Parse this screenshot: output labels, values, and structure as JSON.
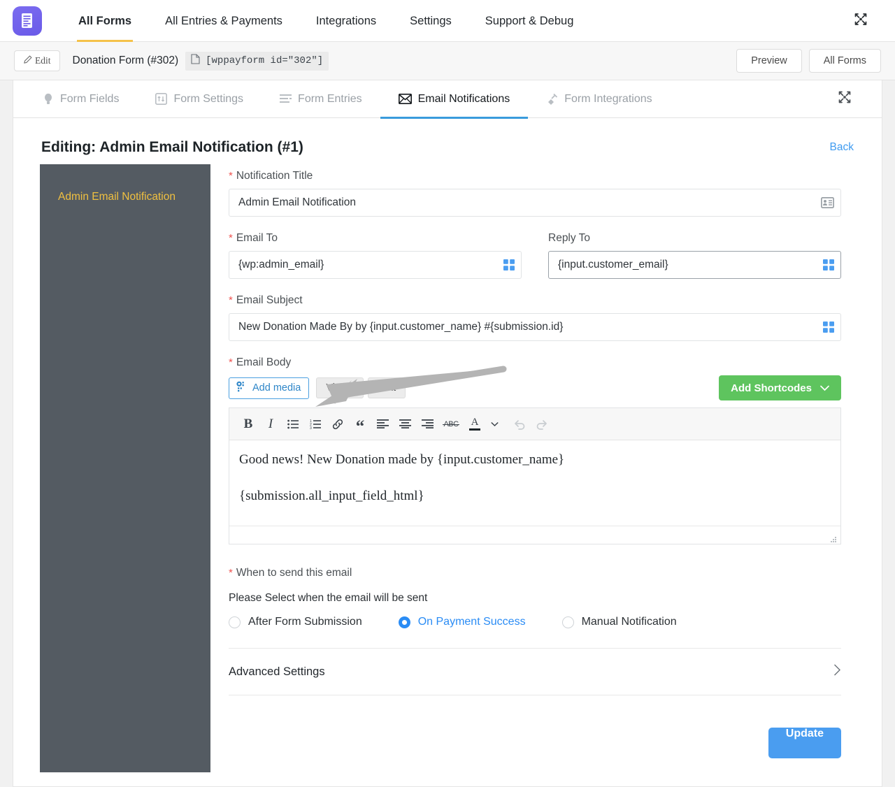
{
  "topnav": {
    "logo_icon": "document-stack-icon",
    "items": [
      {
        "label": "All Forms",
        "active": true
      },
      {
        "label": "All Entries & Payments",
        "active": false
      },
      {
        "label": "Integrations",
        "active": false
      },
      {
        "label": "Settings",
        "active": false
      },
      {
        "label": "Support & Debug",
        "active": false
      }
    ],
    "expand_icon": "expand-arrows-icon"
  },
  "formbar": {
    "edit_label": "Edit",
    "edit_icon": "pencil-icon",
    "form_title": "Donation Form (#302)",
    "shortcode_icon": "copy-page-icon",
    "shortcode": "[wppayform id=\"302\"]",
    "preview_label": "Preview",
    "all_forms_label": "All Forms"
  },
  "subtabs": {
    "items": [
      {
        "label": "Form Fields",
        "icon": "lightbulb-icon",
        "active": false
      },
      {
        "label": "Form Settings",
        "icon": "sliders-icon",
        "active": false
      },
      {
        "label": "Form Entries",
        "icon": "list-lines-icon",
        "active": false
      },
      {
        "label": "Email Notifications",
        "icon": "envelope-icon",
        "active": true
      },
      {
        "label": "Form Integrations",
        "icon": "plug-icon",
        "active": false
      }
    ],
    "expand_icon": "expand-arrows-icon"
  },
  "editing": {
    "title": "Editing: Admin Email Notification (#1)",
    "back_label": "Back"
  },
  "sidebar": {
    "items": [
      {
        "label": "Admin Email Notification",
        "active": true
      }
    ]
  },
  "fields": {
    "notification_title": {
      "label": "Notification Title",
      "required": true,
      "value": "Admin Email Notification",
      "icon": "id-card-icon"
    },
    "email_to": {
      "label": "Email To",
      "required": true,
      "value": "{wp:admin_email}",
      "icon": "shortcode-grid-icon"
    },
    "reply_to": {
      "label": "Reply To",
      "required": false,
      "value": "{input.customer_email}",
      "icon": "shortcode-grid-icon"
    },
    "email_subject": {
      "label": "Email Subject",
      "required": true,
      "value": "New Donation Made By by {input.customer_name} #{submission.id}",
      "icon": "shortcode-grid-icon"
    },
    "email_body": {
      "label": "Email Body",
      "required": true,
      "add_media_label": "Add media",
      "add_media_icon": "media-photos-icon",
      "visual_tab": "Visual",
      "text_tab": "Text",
      "add_shortcodes_label": "Add Shortcodes",
      "add_shortcodes_chevron": "chevron-down-icon",
      "toolbar": [
        {
          "name": "bold-icon",
          "glyph": "B",
          "disabled": false
        },
        {
          "name": "italic-icon",
          "glyph": "I",
          "disabled": false
        },
        {
          "name": "bullet-list-icon",
          "glyph": "",
          "disabled": false
        },
        {
          "name": "numbered-list-icon",
          "glyph": "",
          "disabled": false
        },
        {
          "name": "link-icon",
          "glyph": "",
          "disabled": false
        },
        {
          "name": "blockquote-icon",
          "glyph": "“",
          "disabled": false
        },
        {
          "name": "align-left-icon",
          "glyph": "",
          "disabled": false
        },
        {
          "name": "align-center-icon",
          "glyph": "",
          "disabled": false
        },
        {
          "name": "align-right-icon",
          "glyph": "",
          "disabled": false
        },
        {
          "name": "strikethrough-icon",
          "glyph": "ABC",
          "disabled": false
        },
        {
          "name": "text-color-icon",
          "glyph": "A",
          "disabled": false
        },
        {
          "name": "color-dropdown-icon",
          "glyph": "▾",
          "disabled": false
        },
        {
          "name": "undo-icon",
          "glyph": "",
          "disabled": true
        },
        {
          "name": "redo-icon",
          "glyph": "",
          "disabled": true
        }
      ],
      "content_paragraphs": [
        "Good news! New Donation made by {input.customer_name}",
        "{submission.all_input_field_html}"
      ]
    },
    "when_to_send": {
      "label": "When to send this email",
      "required": true,
      "help": "Please Select when the email will be sent",
      "options": [
        {
          "label": "After Form Submission",
          "selected": false
        },
        {
          "label": "On Payment Success",
          "selected": true
        },
        {
          "label": "Manual Notification",
          "selected": false
        }
      ]
    },
    "advanced_settings": {
      "label": "Advanced Settings",
      "chevron_icon": "chevron-right-icon"
    }
  },
  "footer": {
    "update_label": "Update"
  },
  "annotation": {
    "arrow_icon": "pointer-arrow-annotation",
    "color": "#b0b0b0"
  },
  "colors": {
    "accent_blue": "#4a9df0",
    "green": "#5ec45e",
    "sidebar_bg": "#545b62",
    "sidebar_text": "#f0c040",
    "required_red": "#ef5350",
    "tab_underline": "#3a9bdc",
    "topnav_underline": "#f5c24a"
  }
}
